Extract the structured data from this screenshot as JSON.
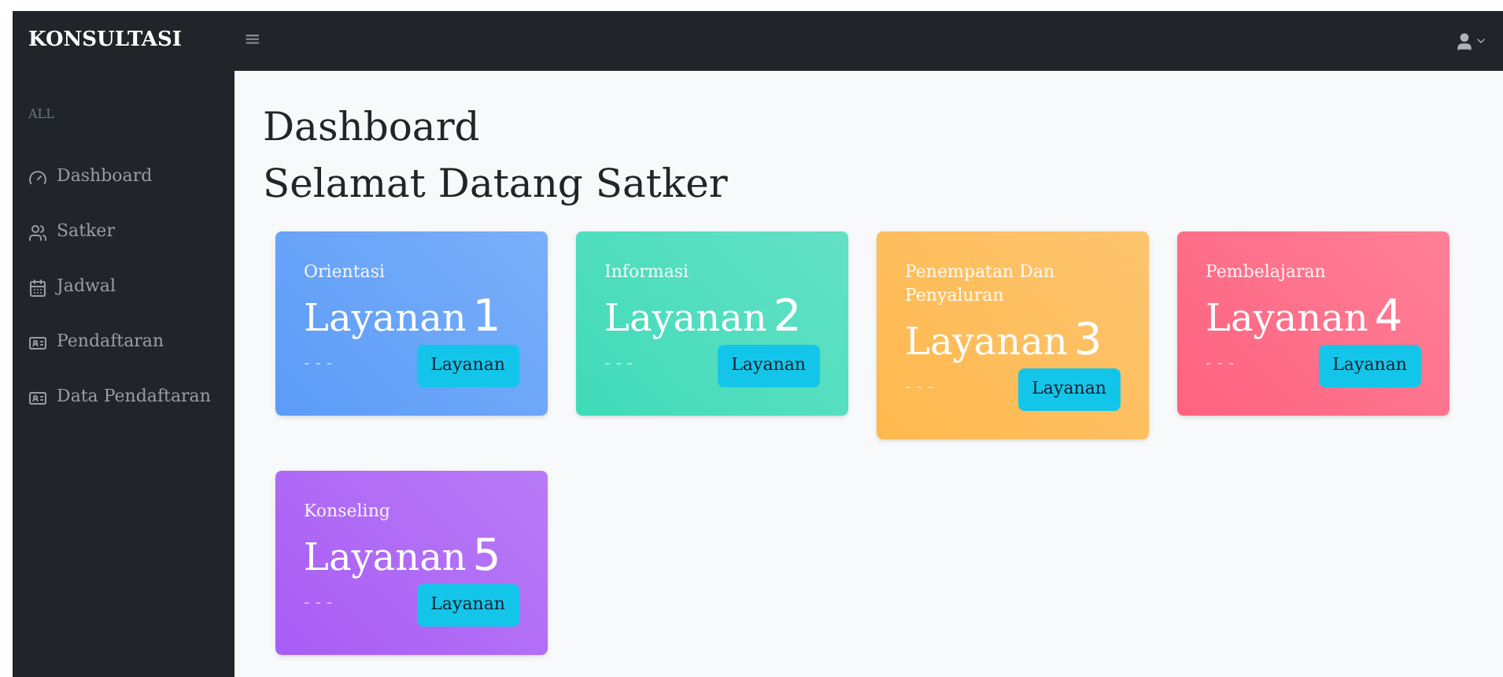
{
  "brand": "KONSULTASI",
  "menu_toggle": "≡",
  "sidebar": {
    "heading": "ALL",
    "items": [
      {
        "label": "Dashboard",
        "kind": "gauge"
      },
      {
        "label": "Satker",
        "kind": "users"
      },
      {
        "label": "Jadwal",
        "kind": "calendar"
      },
      {
        "label": "Pendaftaran",
        "kind": "card"
      },
      {
        "label": "Data Pendaftaran",
        "kind": "card"
      }
    ]
  },
  "page_title": "Dashboard",
  "greeting": "Selamat Datang Satker",
  "cards": [
    {
      "category": "Orientasi",
      "title": "Layanan",
      "number": "1",
      "footer": "- - -",
      "button": "Layanan",
      "color": "#5b9cf8"
    },
    {
      "category": "Informasi",
      "title": "Layanan",
      "number": "2",
      "footer": "- - -",
      "button": "Layanan",
      "color": "#3fdbb8"
    },
    {
      "category": "Penempatan Dan Penyaluran",
      "title": "Layanan",
      "number": "3",
      "footer": "- - -",
      "button": "Layanan",
      "color": "#ffb84d"
    },
    {
      "category": "Pembelajaran",
      "title": "Layanan",
      "number": "4",
      "footer": "- - -",
      "button": "Layanan",
      "color": "#ff627f"
    },
    {
      "category": "Konseling",
      "title": "Layanan",
      "number": "5",
      "footer": "- - -",
      "button": "Layanan",
      "color": "#a85cf5"
    }
  ]
}
